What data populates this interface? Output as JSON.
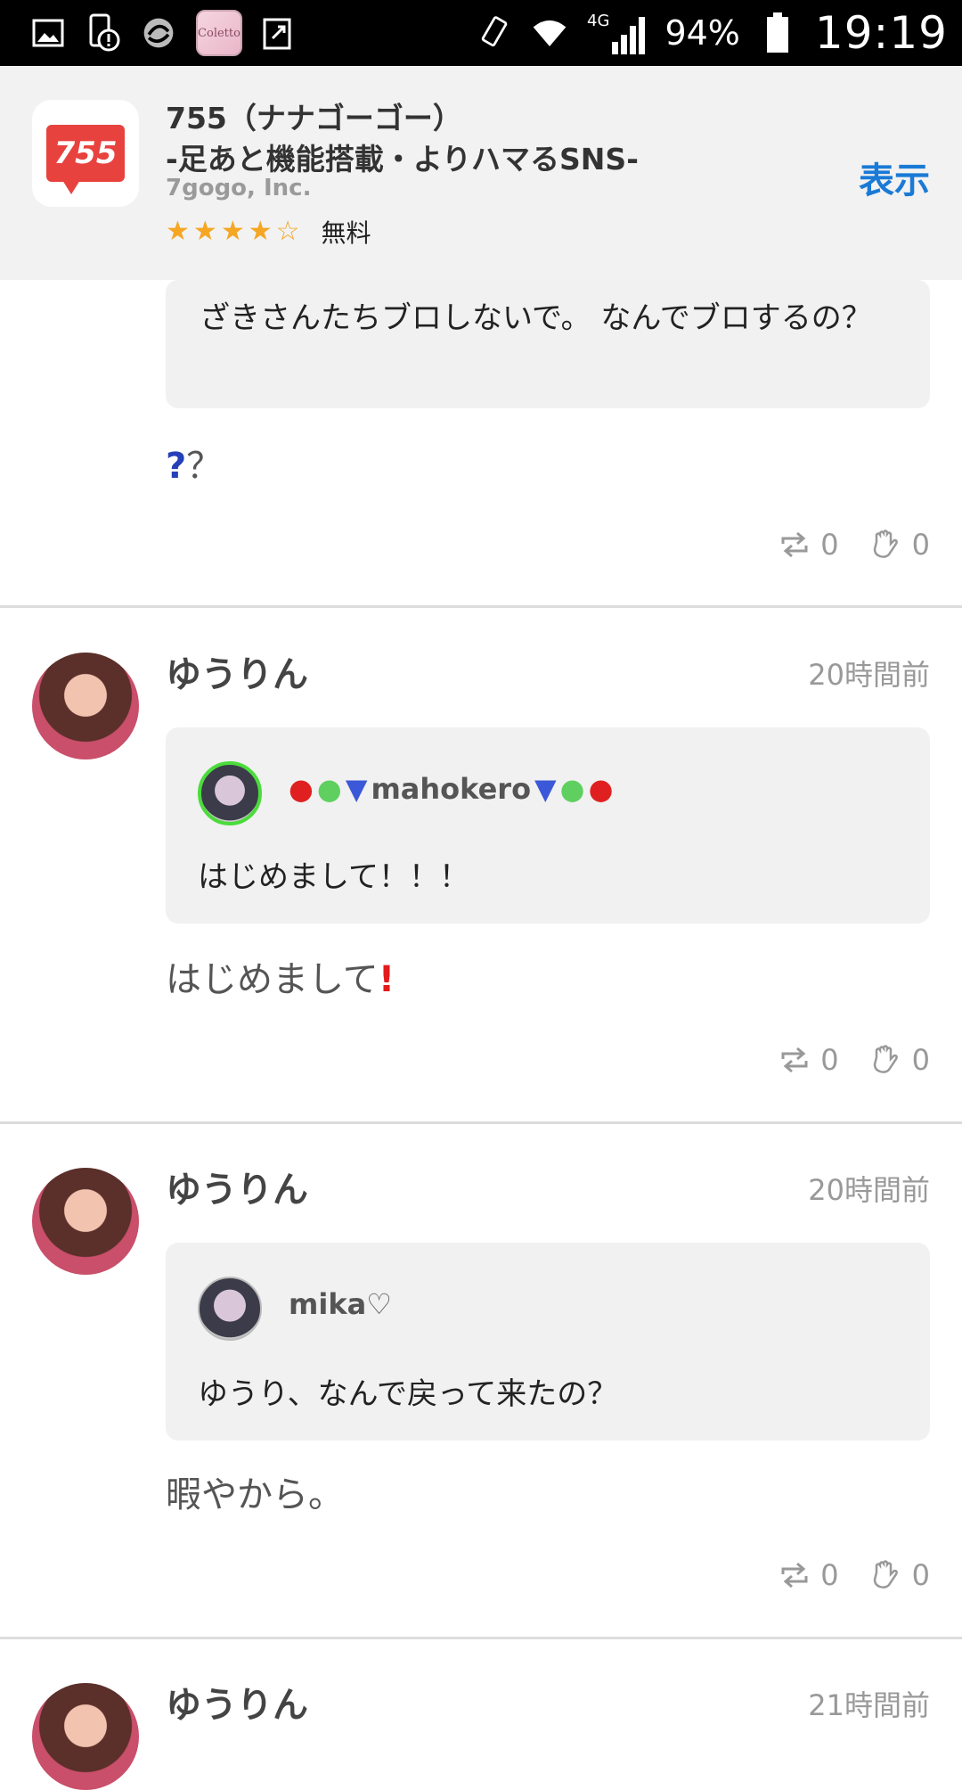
{
  "status_bar": {
    "app_thumb_label": "Coletto",
    "network": "4G",
    "battery": "94%",
    "time": "19:19"
  },
  "banner": {
    "icon_text": "755",
    "title_line1": "755（ナナゴーゴー）",
    "title_line2": "-足あと機能搭載・よりハマるSNS-",
    "developer": "7gogo, Inc.",
    "rating_stars": 4,
    "rating_max": 5,
    "price": "無料",
    "open_label": "表示"
  },
  "posts": [
    {
      "quote_text": "ざきさんたちブロしないで。 なんでブロするの？",
      "body": "？",
      "repost_count": "0",
      "like_count": "0"
    },
    {
      "username": "ゆうりん",
      "time": "20時間前",
      "quote_user": "mahokero",
      "quote_text": "はじめまして！！！",
      "body": "はじめまして",
      "repost_count": "0",
      "like_count": "0"
    },
    {
      "username": "ゆうりん",
      "time": "20時間前",
      "quote_user": "mika♡",
      "quote_text": "ゆうり、なんで戻って来たの？",
      "body": "暇やから。",
      "repost_count": "0",
      "like_count": "0"
    },
    {
      "username": "ゆうりん",
      "time": "21時間前"
    }
  ]
}
